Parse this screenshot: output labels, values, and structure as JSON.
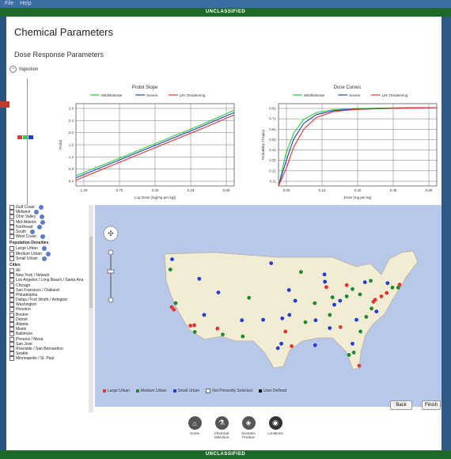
{
  "menubar": {
    "items": [
      "File",
      "Help"
    ]
  },
  "banner": {
    "label": "UNCLASSIFIED"
  },
  "page": {
    "title": "Chemical Parameters",
    "subtitle": "Dose Response Parameters",
    "ingestion_label": "Ingestion"
  },
  "colors": {
    "green": "#2ecc40",
    "blue": "#1f3ed6",
    "red": "#e3342f",
    "banner": "#1e6a2a"
  },
  "chart_data": [
    {
      "type": "line",
      "title": "Probit Slope",
      "xlabel": "Log Dose (log[mg per kg])",
      "ylabel": "Probit",
      "x_ticks": [
        "1.20",
        "0.75",
        "0.30",
        "0.15",
        "0.60"
      ],
      "y_ticks": [
        "2.8",
        "2.4",
        "2.0",
        "1.6",
        "1.2",
        "0.8",
        "0.4"
      ],
      "x": [
        0,
        1,
        2,
        3,
        4,
        5
      ],
      "ylim": [
        0.2,
        3.0
      ],
      "series": [
        {
          "name": "WildMolerate",
          "color": "#2ecc40",
          "values": [
            0.55,
            0.98,
            1.42,
            1.86,
            2.3,
            2.78
          ]
        },
        {
          "name": "Severe",
          "color": "#1f3ed6",
          "values": [
            0.48,
            0.92,
            1.36,
            1.8,
            2.24,
            2.7
          ]
        },
        {
          "name": "Life Threatening",
          "color": "#e3342f",
          "values": [
            0.4,
            0.84,
            1.28,
            1.72,
            2.16,
            2.62
          ]
        }
      ]
    },
    {
      "type": "line",
      "title": "Dose Curves",
      "xlabel": "Dose (mg per kg)",
      "ylabel": "Probability of Injury",
      "x_ticks": [
        "0.00",
        "0.15",
        "0.30",
        "0.45",
        "0.60"
      ],
      "y_ticks": [
        "0.81",
        "0.71",
        "0.61",
        "0.51",
        "0.41",
        "0.31",
        "0.21",
        "0.11"
      ],
      "x": [
        0,
        0.03,
        0.06,
        0.1,
        0.15,
        0.22,
        0.3,
        0.4,
        0.5,
        0.63
      ],
      "ylim": [
        0.05,
        0.88
      ],
      "series": [
        {
          "name": "WildMolerate",
          "color": "#2ecc40",
          "values": [
            0.05,
            0.38,
            0.58,
            0.72,
            0.79,
            0.82,
            0.83,
            0.835,
            0.84,
            0.84
          ]
        },
        {
          "name": "Severe",
          "color": "#1f3ed6",
          "values": [
            0.05,
            0.3,
            0.52,
            0.68,
            0.77,
            0.81,
            0.825,
            0.83,
            0.835,
            0.84
          ]
        },
        {
          "name": "Life Threatening",
          "color": "#e3342f",
          "values": [
            0.05,
            0.22,
            0.44,
            0.62,
            0.74,
            0.8,
            0.82,
            0.83,
            0.835,
            0.84
          ]
        }
      ]
    }
  ],
  "sidebar": {
    "regions": [
      "Gulf Coast",
      "Midwest",
      "Ohio Valley",
      "Mid-Atlantic",
      "Northeast",
      "South",
      "West Coast"
    ],
    "pop_header": "Population Densities",
    "densities": [
      "Large Urban",
      "Medium Urban",
      "Small Urban"
    ],
    "cities_header": "Cities",
    "cities": [
      "All",
      "New York / Newark",
      "Los Angeles / Long Beach / Santa Ana",
      "Chicago",
      "San Francisco / Oakland",
      "Philadelphia",
      "Dallas / Fort Worth / Arlington",
      "Washington",
      "Houston",
      "Boston",
      "Detroit",
      "Atlanta",
      "Miami",
      "Baltimore",
      "Phoenix / Mesa",
      "San Jose",
      "Riverside / San Bernardino",
      "Seattle",
      "Minneapolis / St. Paul"
    ]
  },
  "map": {
    "legend": [
      {
        "label": "Large Urban",
        "color": "#e3342f"
      },
      {
        "label": "Medium Urban",
        "color": "#1e8a2e"
      },
      {
        "label": "Small Urban",
        "color": "#1f3ed6"
      },
      {
        "label": "Not Presently Selected",
        "color": "#ffffff"
      },
      {
        "label": "User Defined",
        "color": "#111111"
      }
    ],
    "markers": [
      {
        "lon": -122.4,
        "lat": 37.8,
        "c": "red"
      },
      {
        "lon": -118.2,
        "lat": 34.0,
        "c": "red"
      },
      {
        "lon": -117.3,
        "lat": 34.1,
        "c": "red"
      },
      {
        "lon": -121.9,
        "lat": 37.3,
        "c": "red"
      },
      {
        "lon": -122.3,
        "lat": 47.6,
        "c": "blue"
      },
      {
        "lon": -122.7,
        "lat": 45.5,
        "c": "green"
      },
      {
        "lon": -117.2,
        "lat": 32.7,
        "c": "green"
      },
      {
        "lon": -121.5,
        "lat": 38.6,
        "c": "green"
      },
      {
        "lon": -112.1,
        "lat": 33.4,
        "c": "red"
      },
      {
        "lon": -115.1,
        "lat": 36.2,
        "c": "blue"
      },
      {
        "lon": -111.9,
        "lat": 40.8,
        "c": "blue"
      },
      {
        "lon": -105.0,
        "lat": 39.7,
        "c": "green"
      },
      {
        "lon": -106.6,
        "lat": 35.1,
        "c": "blue"
      },
      {
        "lon": -110.9,
        "lat": 32.2,
        "c": "green"
      },
      {
        "lon": -116.2,
        "lat": 43.6,
        "c": "blue"
      },
      {
        "lon": -96.8,
        "lat": 32.8,
        "c": "red"
      },
      {
        "lon": -95.4,
        "lat": 29.8,
        "c": "red"
      },
      {
        "lon": -98.5,
        "lat": 29.4,
        "c": "blue"
      },
      {
        "lon": -97.7,
        "lat": 30.3,
        "c": "blue"
      },
      {
        "lon": -97.5,
        "lat": 35.5,
        "c": "blue"
      },
      {
        "lon": -95.9,
        "lat": 36.2,
        "c": "blue"
      },
      {
        "lon": -94.6,
        "lat": 39.1,
        "c": "blue"
      },
      {
        "lon": -93.3,
        "lat": 45.0,
        "c": "green"
      },
      {
        "lon": -96.0,
        "lat": 41.3,
        "c": "blue"
      },
      {
        "lon": -90.2,
        "lat": 38.6,
        "c": "green"
      },
      {
        "lon": -87.6,
        "lat": 41.9,
        "c": "red"
      },
      {
        "lon": -87.9,
        "lat": 43.0,
        "c": "blue"
      },
      {
        "lon": -86.2,
        "lat": 39.8,
        "c": "green"
      },
      {
        "lon": -84.5,
        "lat": 39.1,
        "c": "blue"
      },
      {
        "lon": -83.0,
        "lat": 40.0,
        "c": "green"
      },
      {
        "lon": -81.7,
        "lat": 41.5,
        "c": "green"
      },
      {
        "lon": -83.0,
        "lat": 42.3,
        "c": "red"
      },
      {
        "lon": -80.0,
        "lat": 40.4,
        "c": "green"
      },
      {
        "lon": -85.8,
        "lat": 38.3,
        "c": "blue"
      },
      {
        "lon": -86.8,
        "lat": 36.2,
        "c": "green"
      },
      {
        "lon": -90.0,
        "lat": 35.1,
        "c": "blue"
      },
      {
        "lon": -84.4,
        "lat": 33.7,
        "c": "red"
      },
      {
        "lon": -86.8,
        "lat": 33.5,
        "c": "blue"
      },
      {
        "lon": -90.1,
        "lat": 30.0,
        "c": "blue"
      },
      {
        "lon": -81.7,
        "lat": 30.3,
        "c": "blue"
      },
      {
        "lon": -82.5,
        "lat": 28.0,
        "c": "green"
      },
      {
        "lon": -81.4,
        "lat": 28.5,
        "c": "green"
      },
      {
        "lon": -80.2,
        "lat": 25.8,
        "c": "red"
      },
      {
        "lon": -80.8,
        "lat": 35.2,
        "c": "blue"
      },
      {
        "lon": -78.6,
        "lat": 35.8,
        "c": "green"
      },
      {
        "lon": -77.4,
        "lat": 37.5,
        "c": "green"
      },
      {
        "lon": -76.3,
        "lat": 36.9,
        "c": "blue"
      },
      {
        "lon": -77.0,
        "lat": 38.9,
        "c": "red"
      },
      {
        "lon": -76.6,
        "lat": 39.3,
        "c": "red"
      },
      {
        "lon": -75.2,
        "lat": 40.0,
        "c": "red"
      },
      {
        "lon": -74.0,
        "lat": 40.7,
        "c": "red"
      },
      {
        "lon": -73.8,
        "lat": 42.7,
        "c": "blue"
      },
      {
        "lon": -71.1,
        "lat": 42.4,
        "c": "red"
      },
      {
        "lon": -71.4,
        "lat": 41.8,
        "c": "green"
      },
      {
        "lon": -72.7,
        "lat": 41.8,
        "c": "green"
      },
      {
        "lon": -78.9,
        "lat": 42.9,
        "c": "blue"
      },
      {
        "lon": -77.6,
        "lat": 43.2,
        "c": "green"
      },
      {
        "lon": -79.9,
        "lat": 32.8,
        "c": "green"
      },
      {
        "lon": -100.0,
        "lat": 46.8,
        "c": "blue"
      },
      {
        "lon": -88.0,
        "lat": 44.5,
        "c": "blue"
      },
      {
        "lon": -92.3,
        "lat": 34.7,
        "c": "green"
      },
      {
        "lon": -101.8,
        "lat": 35.2,
        "c": "blue"
      },
      {
        "lon": -106.4,
        "lat": 31.8,
        "c": "green"
      }
    ]
  },
  "footer": {
    "back_label": "Back",
    "finish_label": "Finish",
    "nav": [
      {
        "label": "Home",
        "icon": "home-icon"
      },
      {
        "label": "Chemical Selection",
        "icon": "flask-icon"
      },
      {
        "label": "Scenario Position",
        "icon": "position-icon"
      },
      {
        "label": "Locations",
        "icon": "globe-icon"
      }
    ]
  }
}
